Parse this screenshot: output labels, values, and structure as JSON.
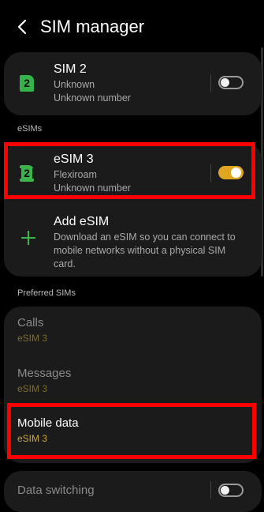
{
  "header": {
    "title": "SIM manager"
  },
  "sim2": {
    "badge": "2",
    "name": "SIM 2",
    "carrier": "Unknown",
    "number": "Unknown number",
    "enabled": false
  },
  "esims": {
    "section": "eSIMs",
    "esim3": {
      "badge": "2",
      "name": "eSIM 3",
      "carrier": "Flexiroam",
      "number": "Unknown number",
      "enabled": true
    },
    "add": {
      "title": "Add eSIM",
      "description": "Download an eSIM so you can connect to mobile networks without a physical SIM card."
    }
  },
  "preferred": {
    "section": "Preferred SIMs",
    "calls": {
      "label": "Calls",
      "value": "eSIM 3"
    },
    "messages": {
      "label": "Messages",
      "value": "eSIM 3"
    },
    "mobile_data": {
      "label": "Mobile data",
      "value": "eSIM 3"
    }
  },
  "data_switching": {
    "label": "Data switching",
    "enabled": false
  },
  "colors": {
    "accent_gold": "#e1a621",
    "sim_green": "#35b34a",
    "highlight": "#ff0000"
  }
}
